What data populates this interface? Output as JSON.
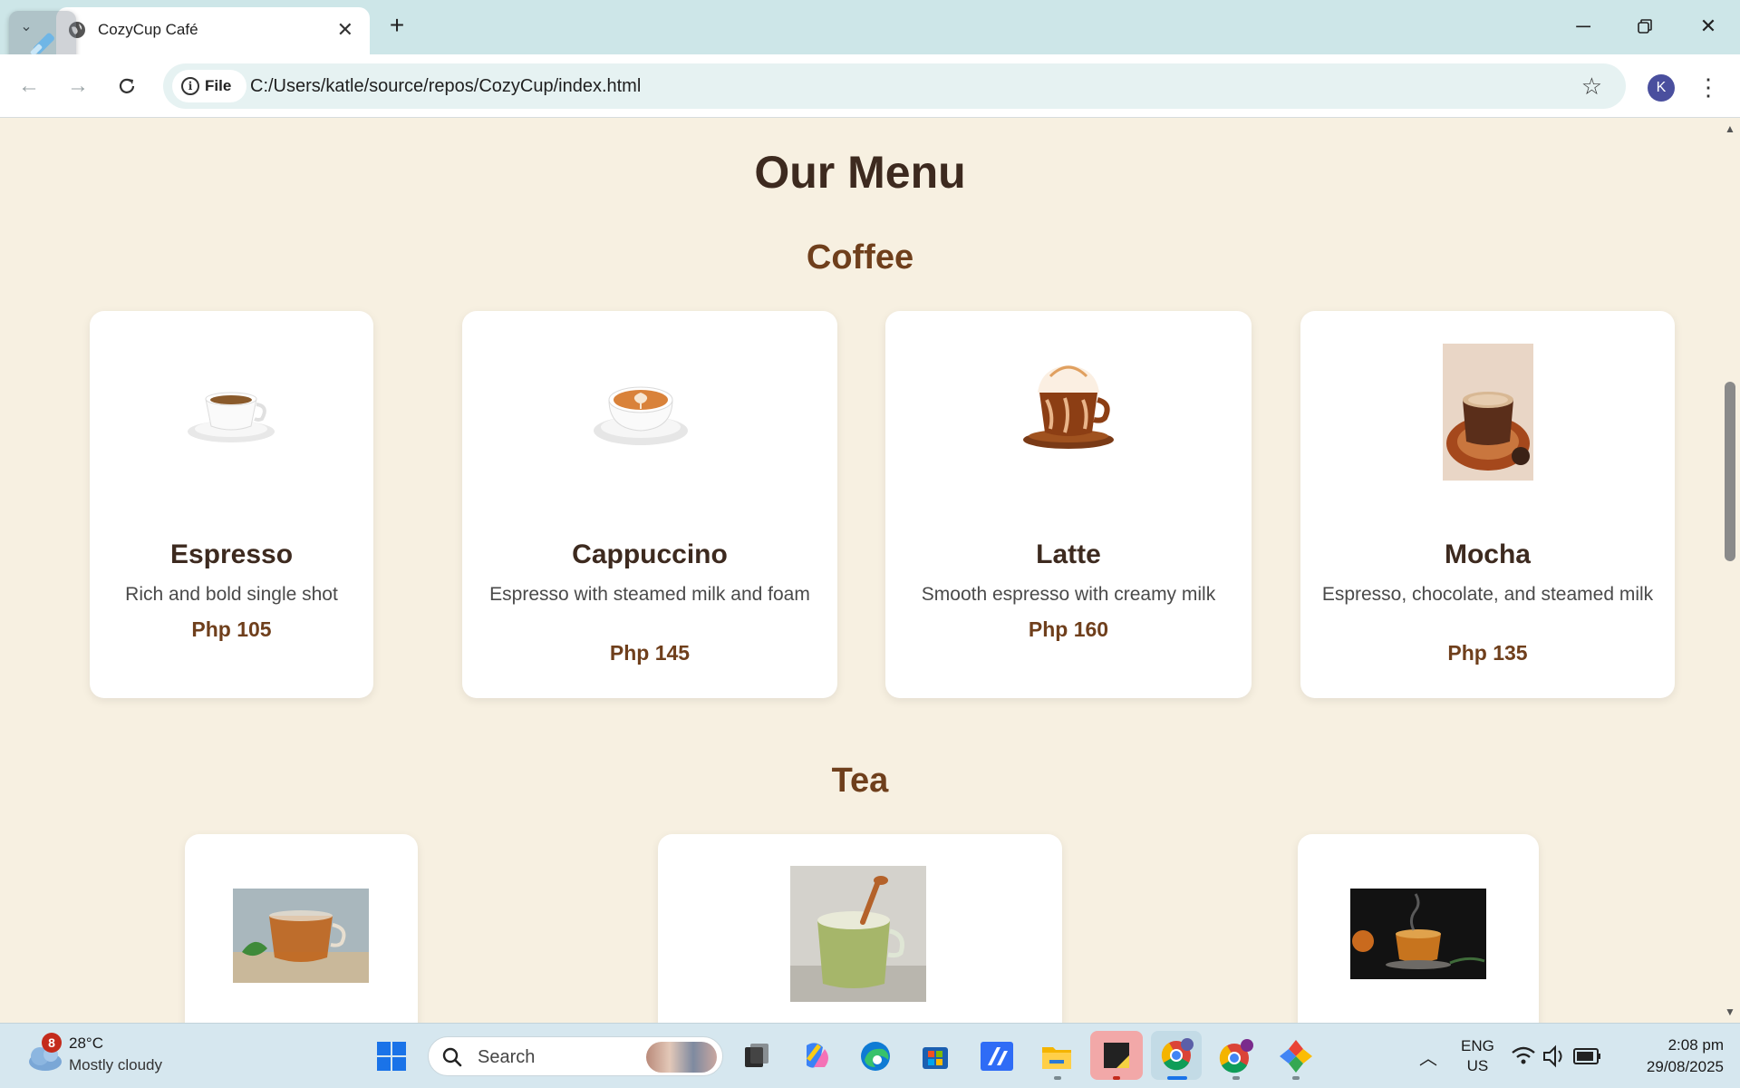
{
  "browser": {
    "tab_title": "CozyCup Café",
    "new_tab_symbol": "+",
    "address": {
      "chip_label": "File",
      "url": "C:/Users/katle/source/repos/CozyCup/index.html"
    },
    "profile_initial": "K"
  },
  "page": {
    "title": "Our Menu",
    "sections": {
      "coffee": {
        "title": "Coffee",
        "items": [
          {
            "name": "Espresso",
            "description": "Rich and bold single shot",
            "price": "Php 105"
          },
          {
            "name": "Cappuccino",
            "description": "Espresso with steamed milk and foam",
            "price": "Php 145"
          },
          {
            "name": "Latte",
            "description": "Smooth espresso with creamy milk",
            "price": "Php 160"
          },
          {
            "name": "Mocha",
            "description": "Espresso, chocolate, and steamed milk",
            "price": "Php 135"
          }
        ]
      },
      "tea": {
        "title": "Tea"
      }
    }
  },
  "taskbar": {
    "weather": {
      "badge": "8",
      "temperature": "28°C",
      "condition": "Mostly cloudy"
    },
    "search_placeholder": "Search",
    "language": {
      "line1": "ENG",
      "line2": "US"
    },
    "clock": {
      "time": "2:08 pm",
      "date": "29/08/2025"
    }
  },
  "colors": {
    "page_background": "#f7f0e1",
    "heading_dark": "#3d2a1f",
    "heading_brown": "#6f3f1c",
    "card_background": "#ffffff"
  }
}
